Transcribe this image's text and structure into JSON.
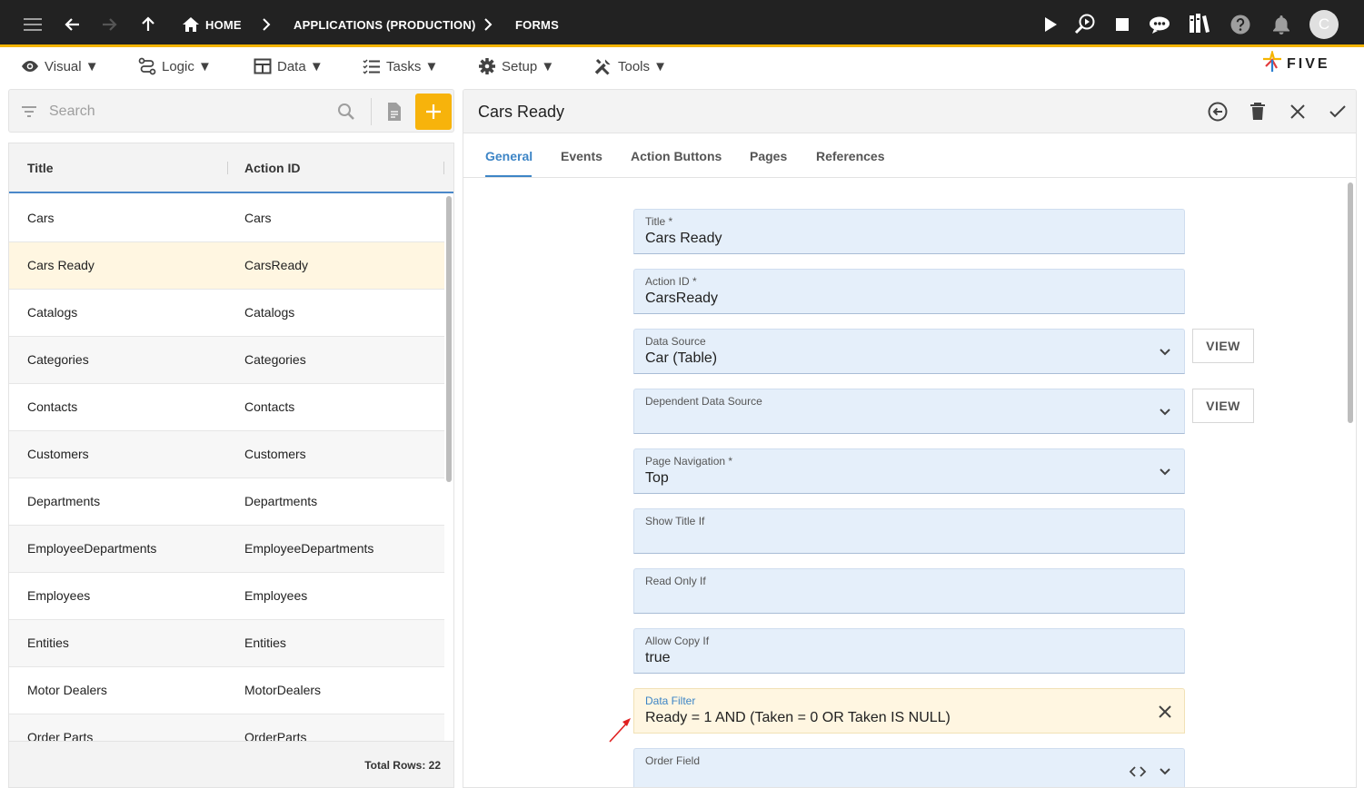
{
  "appbar": {
    "breadcrumbs": [
      "HOME",
      "APPLICATIONS (PRODUCTION)",
      "FORMS"
    ],
    "avatar_letter": "C"
  },
  "menu": {
    "items": [
      "Visual ▼",
      "Logic ▼",
      "Data ▼",
      "Tasks ▼",
      "Setup ▼",
      "Tools ▼"
    ],
    "logo_text": "FIVE"
  },
  "search": {
    "placeholder": "Search"
  },
  "list": {
    "columns": [
      "Title",
      "Action ID"
    ],
    "rows": [
      {
        "title": "Cars",
        "action_id": "Cars"
      },
      {
        "title": "Cars Ready",
        "action_id": "CarsReady"
      },
      {
        "title": "Catalogs",
        "action_id": "Catalogs"
      },
      {
        "title": "Categories",
        "action_id": "Categories"
      },
      {
        "title": "Contacts",
        "action_id": "Contacts"
      },
      {
        "title": "Customers",
        "action_id": "Customers"
      },
      {
        "title": "Departments",
        "action_id": "Departments"
      },
      {
        "title": "EmployeeDepartments",
        "action_id": "EmployeeDepartments"
      },
      {
        "title": "Employees",
        "action_id": "Employees"
      },
      {
        "title": "Entities",
        "action_id": "Entities"
      },
      {
        "title": "Motor Dealers",
        "action_id": "MotorDealers"
      },
      {
        "title": "Order Parts",
        "action_id": "OrderParts"
      }
    ],
    "footer": "Total Rows: 22"
  },
  "detail": {
    "title": "Cars Ready",
    "tabs": [
      "General",
      "Events",
      "Action Buttons",
      "Pages",
      "References"
    ],
    "view_label": "VIEW",
    "fields": {
      "title": {
        "label": "Title *",
        "value": "Cars Ready"
      },
      "action_id": {
        "label": "Action ID *",
        "value": "CarsReady"
      },
      "data_source": {
        "label": "Data Source",
        "value": "Car (Table)"
      },
      "dependent_data_source": {
        "label": "Dependent Data Source",
        "value": ""
      },
      "page_navigation": {
        "label": "Page Navigation *",
        "value": "Top"
      },
      "show_title_if": {
        "label": "Show Title If",
        "value": ""
      },
      "read_only_if": {
        "label": "Read Only If",
        "value": ""
      },
      "allow_copy_if": {
        "label": "Allow Copy If",
        "value": "true"
      },
      "data_filter": {
        "label": "Data Filter",
        "value": "Ready = 1 AND (Taken = 0 OR Taken IS NULL)"
      },
      "order_field": {
        "label": "Order Field",
        "value": ""
      }
    }
  },
  "colors": {
    "appbar": "#222222",
    "accent": "#f5b400",
    "primary": "#3d85c6",
    "field_bg": "#e5effa",
    "selected_row": "#fff6e1"
  }
}
